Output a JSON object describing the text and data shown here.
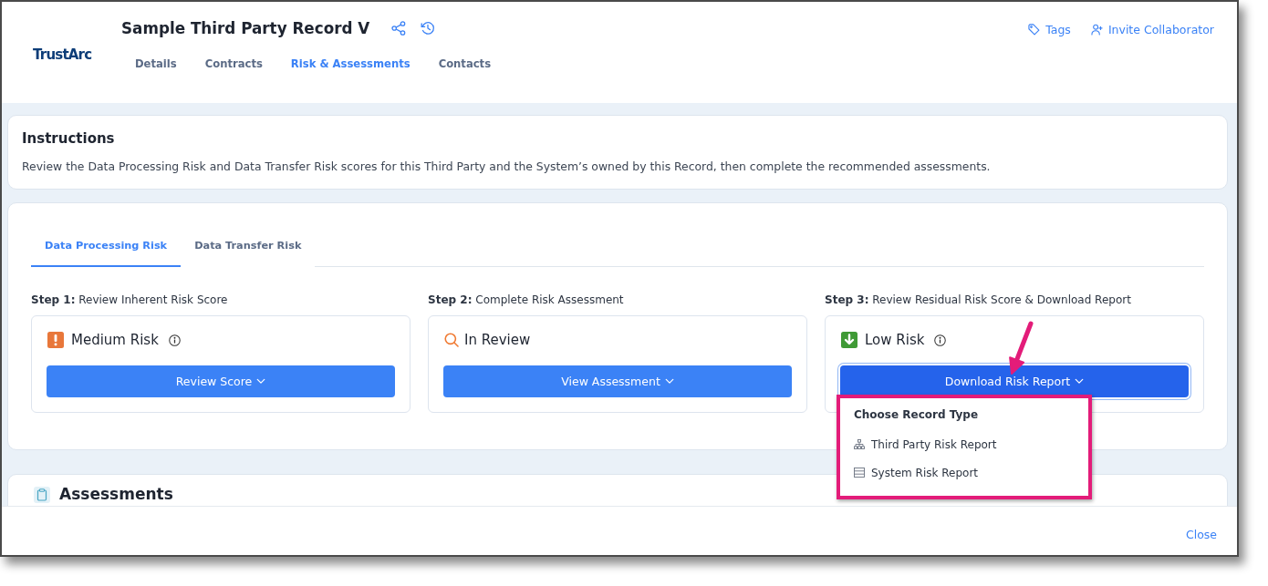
{
  "window": {
    "logo": "TrustArc",
    "title": "Sample Third Party Record V",
    "tabs": [
      {
        "label": "Details",
        "selected": false
      },
      {
        "label": "Contracts",
        "selected": false
      },
      {
        "label": "Risk & Assessments",
        "selected": true
      },
      {
        "label": "Contacts",
        "selected": false
      }
    ],
    "actions": [
      {
        "kind": "tags",
        "label": "Tags"
      },
      {
        "kind": "invite",
        "label": "Invite Collaborator"
      }
    ]
  },
  "instructions": {
    "title": "Instructions",
    "text": "Review the Data Processing Risk and Data Transfer Risk scores for this Third Party and the System’s owned by this Record, then complete the recommended assessments."
  },
  "risk_tabs": [
    {
      "label": "Data Processing Risk",
      "selected": true
    },
    {
      "label": "Data Transfer Risk",
      "selected": false
    }
  ],
  "steps": [
    {
      "heading": "**Step 1:** Review Inherent Risk Score",
      "kind": "medium",
      "status": "Medium Risk",
      "info": true,
      "button": "Review Score",
      "focused": false
    },
    {
      "heading": "**Step 2:** Complete Risk Assessment",
      "kind": "review",
      "status": "In Review",
      "info": false,
      "button": "View Assessment",
      "focused": false
    },
    {
      "heading": "**Step 3:** Review Residual Risk Score & Download Report",
      "kind": "low",
      "status": "Low Risk",
      "info": true,
      "button": "Download Risk Report",
      "focused": true,
      "menu": {
        "heading": "Choose Record Type",
        "items": [
          {
            "kind": "hierarchy",
            "label": "Third Party Risk Report"
          },
          {
            "kind": "list",
            "label": "System Risk Report"
          }
        ]
      }
    }
  ],
  "assessments": {
    "title": "Assessments"
  },
  "footer": {
    "close": "Close"
  }
}
